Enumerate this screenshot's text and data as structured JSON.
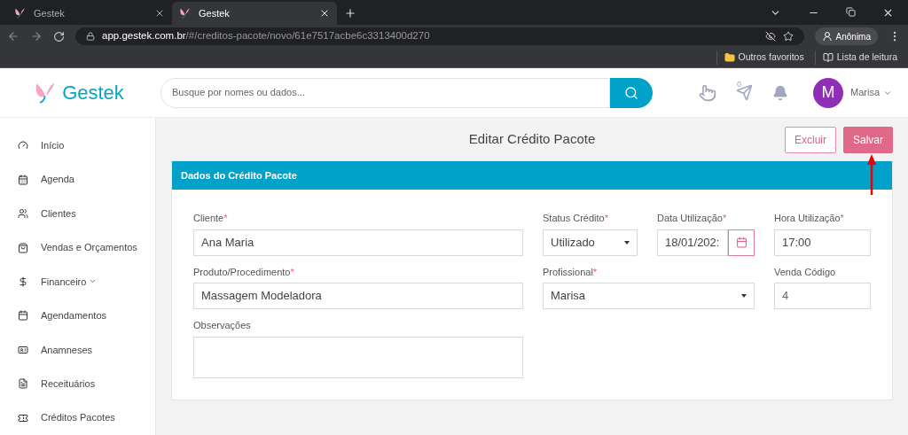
{
  "browser": {
    "tabs": [
      {
        "title": "Gestek",
        "selected": false
      },
      {
        "title": "Gestek",
        "selected": true
      }
    ],
    "address": {
      "host": "app.gestek.com.br",
      "path": "/#/creditos-pacote/novo/61e7517acbe6c3313400d270"
    },
    "profile": "Anônima",
    "bookmarks": [
      "Outros favoritos",
      "Lista de leitura"
    ]
  },
  "header": {
    "logo": "Gestek",
    "search": {
      "placeholder": "Busque por nomes ou dados..."
    },
    "badge": "0",
    "avatar": "M",
    "user": "Marisa"
  },
  "sidebar": {
    "items": [
      {
        "label": "Início",
        "submenu": false
      },
      {
        "label": "Agenda",
        "submenu": false
      },
      {
        "label": "Clientes",
        "submenu": false
      },
      {
        "label": "Vendas e Orçamentos",
        "submenu": false
      },
      {
        "label": "Financeiro",
        "submenu": true
      },
      {
        "label": "Agendamentos",
        "submenu": false
      },
      {
        "label": "Anamneses",
        "submenu": false
      },
      {
        "label": "Receituários",
        "submenu": false
      },
      {
        "label": "Créditos Pacotes",
        "submenu": false
      }
    ]
  },
  "page": {
    "title": "Editar Crédito Pacote",
    "buttons": [
      {
        "label": "Excluir",
        "kind": "outline"
      },
      {
        "label": "Salvar",
        "kind": "solid"
      }
    ],
    "card_title": "Dados do Crédito Pacote",
    "fields": [
      {
        "label": "Cliente",
        "required_mark": "*",
        "value": "Ana Maria",
        "kind": "text"
      },
      {
        "label": "Status Crédito",
        "required_mark": "*",
        "value": "Utilizado",
        "kind": "select"
      },
      {
        "label": "Data Utilização",
        "required_mark": "*",
        "value": "18/01/202:",
        "kind": "date"
      },
      {
        "label": "Hora Utilização",
        "required_mark": "*",
        "value": "17:00",
        "kind": "text"
      },
      {
        "label": "Produto/Procedimento",
        "required_mark": "*",
        "value": "Massagem Modeladora",
        "kind": "text"
      },
      {
        "label": "Profissional",
        "required_mark": "*",
        "value": "Marisa",
        "kind": "select"
      },
      {
        "label": "Venda Código",
        "value": "4",
        "kind": "readonly"
      },
      {
        "label": "Observações",
        "kind": "textarea"
      }
    ]
  }
}
